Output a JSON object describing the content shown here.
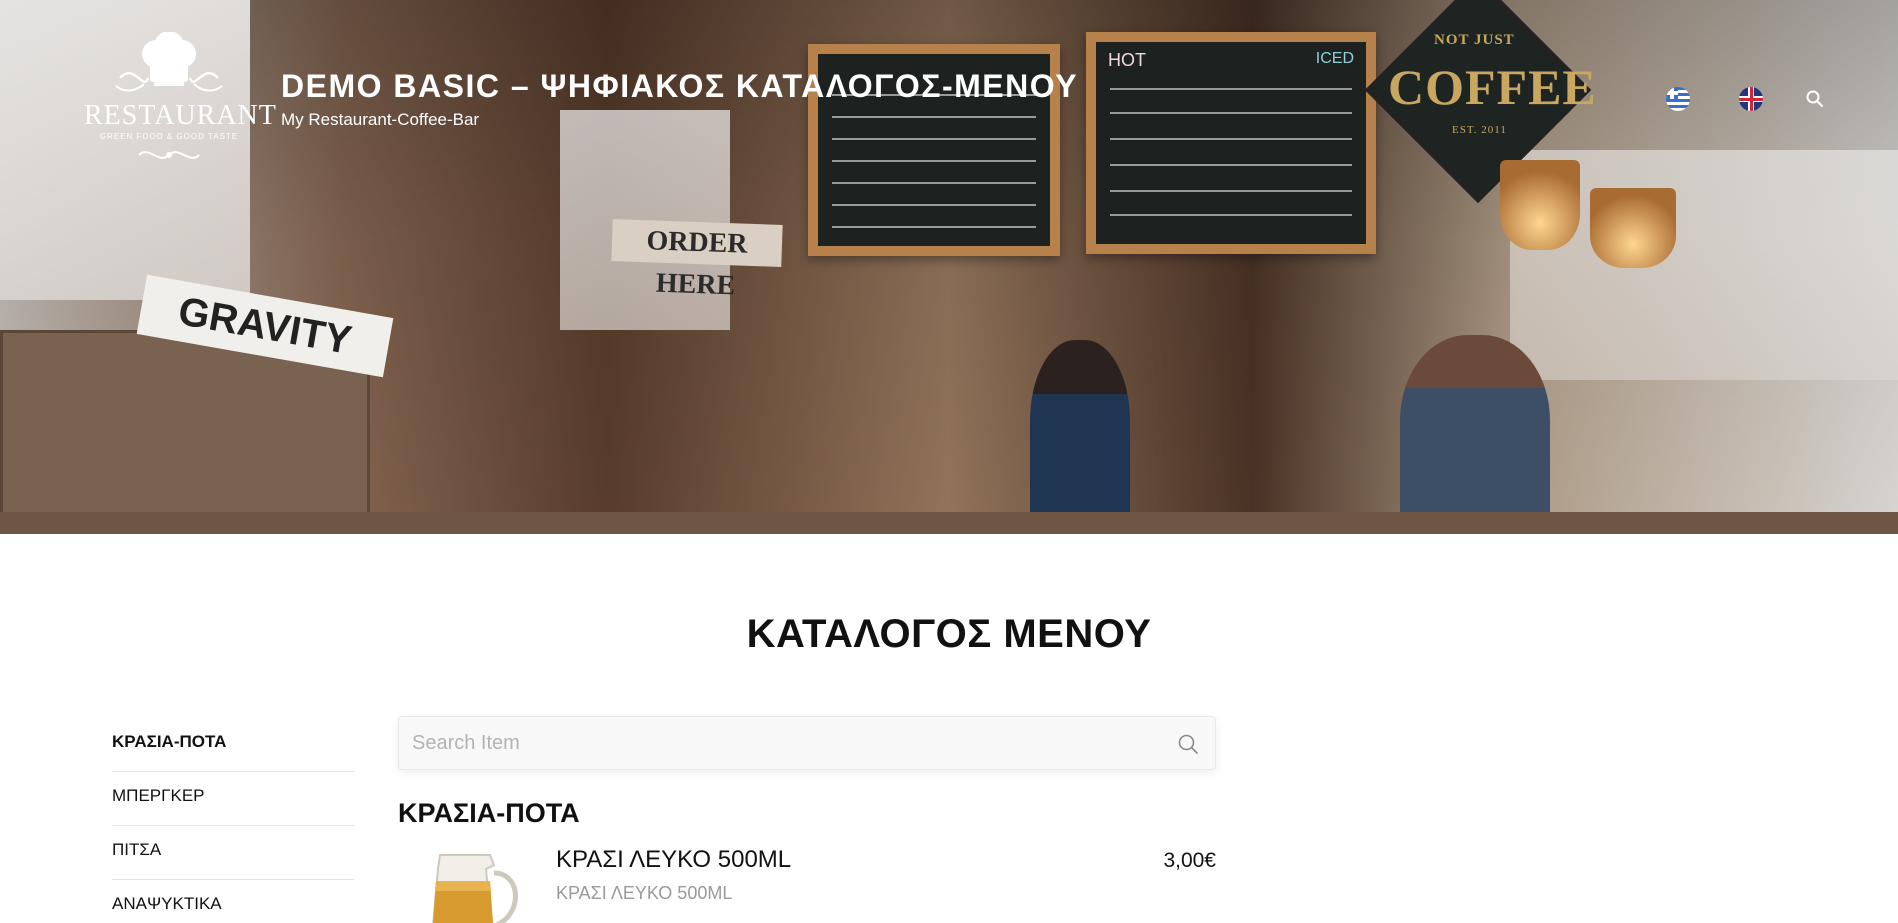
{
  "header": {
    "logo": {
      "brand": "RESTAURANT",
      "tagline": "GREEN FOOD & GOOD TASTE"
    },
    "site_title": "DEMO BASIC – ΨΗΦΙΑΚΟΣ ΚΑΤΑΛΟΓΟΣ-ΜΕΝΟΥ",
    "site_subtitle": "My Restaurant-Coffee-Bar",
    "languages": [
      {
        "code": "el",
        "icon": "greek-flag-icon"
      },
      {
        "code": "en",
        "icon": "uk-flag-icon"
      }
    ],
    "search_icon": "search-icon"
  },
  "hero": {
    "signs": {
      "order": "ORDER HERE",
      "hot": "HOT",
      "iced": "ICED",
      "coffee_top": "NOT JUST",
      "coffee_main": "COFFEE",
      "coffee_est": "EST. 2011",
      "crate": "GRAVITY"
    }
  },
  "main": {
    "heading": "ΚΑΤΑΛΟΓΟΣ ΜΕΝΟΥ",
    "categories": [
      {
        "label": "ΚΡΑΣΙΑ-ΠΟΤΑ",
        "active": true
      },
      {
        "label": "ΜΠΕΡΓΚΕΡ",
        "active": false
      },
      {
        "label": "ΠΙΤΣΑ",
        "active": false
      },
      {
        "label": "ΑΝΑΨΥΚΤΙΚΑ",
        "active": false
      }
    ],
    "search": {
      "placeholder": "Search Item",
      "value": ""
    },
    "section_title": "ΚΡΑΣΙΑ-ΠΟΤΑ",
    "items": [
      {
        "name": "ΚΡΑΣΙ ΛΕΥΚΟ 500ML",
        "description": "ΚΡΑΣΙ ΛΕΥΚΟ 500ML",
        "price": "3,00€"
      }
    ]
  },
  "colors": {
    "accent_text": "#111111",
    "muted_text": "#9a9a9a",
    "divider": "#e3e3e3"
  }
}
